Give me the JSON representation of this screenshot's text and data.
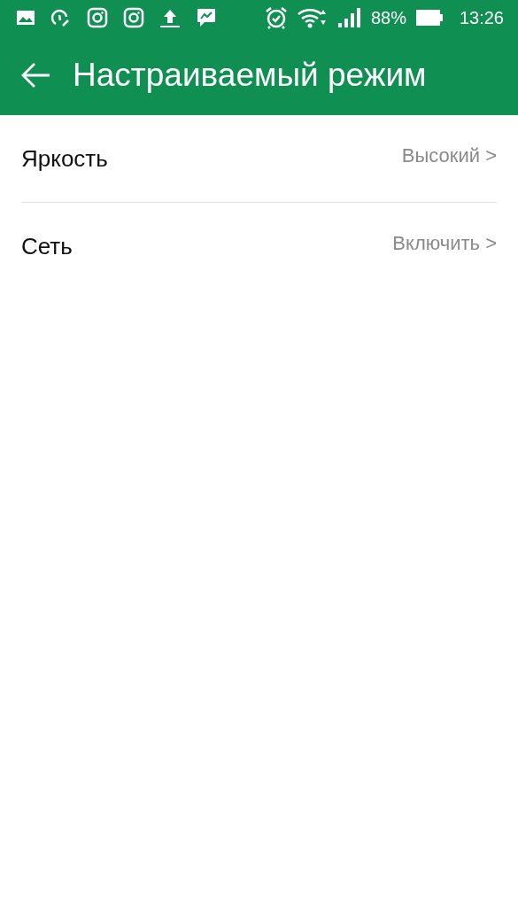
{
  "status_bar": {
    "battery": "88%",
    "time": "13:26"
  },
  "toolbar": {
    "title": "Настраиваемый режим"
  },
  "settings": [
    {
      "label": "Яркость",
      "value": "Высокий >"
    },
    {
      "label": "Сеть",
      "value": "Включить >"
    }
  ]
}
